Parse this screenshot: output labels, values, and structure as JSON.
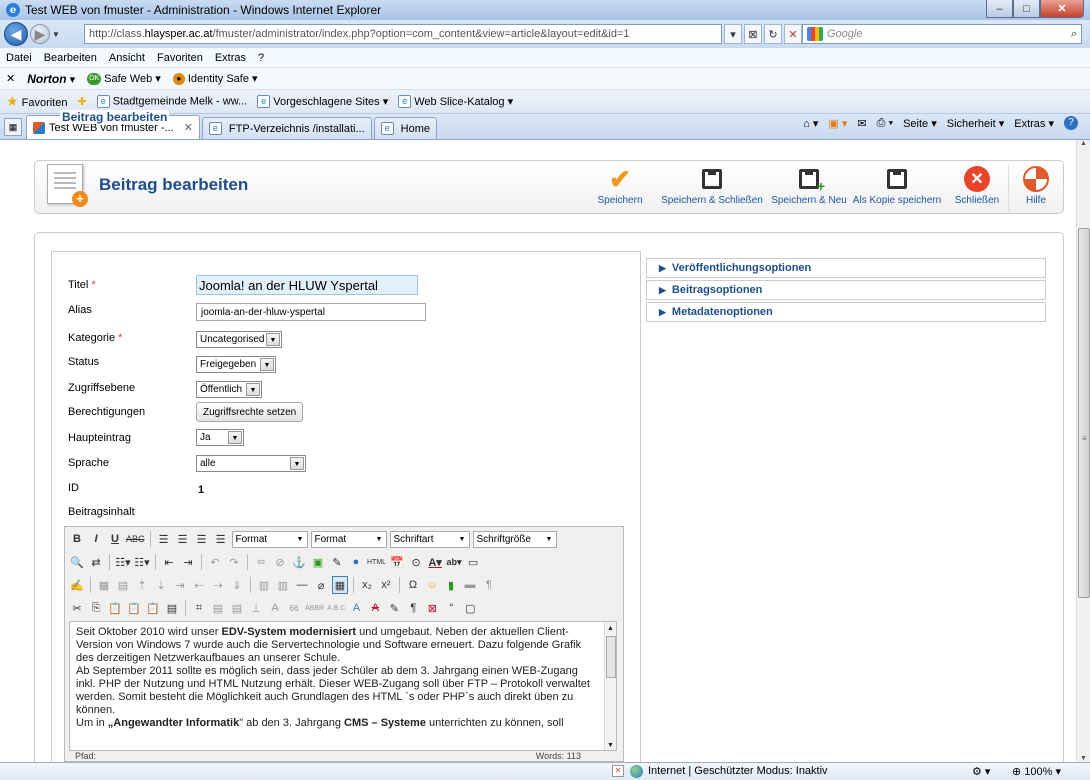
{
  "window": {
    "title": "Test WEB von fmuster - Administration - Windows Internet Explorer"
  },
  "browser": {
    "url_prefix": "http://class.",
    "url_domain": "hlaysper.ac.at",
    "url_suffix": "/fmuster/administrator/index.php?option=com_content&view=article&layout=edit&id=1",
    "search_placeholder": "Google"
  },
  "menu": [
    "Datei",
    "Bearbeiten",
    "Ansicht",
    "Favoriten",
    "Extras",
    "?"
  ],
  "norton": {
    "brand": "Norton",
    "safe_web": "Safe Web",
    "identity_safe": "Identity Safe"
  },
  "favorites": {
    "label": "Favoriten",
    "items": [
      "Stadtgemeinde Melk - ww...",
      "Vorgeschlagene Sites",
      "Web Slice-Katalog"
    ]
  },
  "tabs": [
    "Test WEB von fmuster -...",
    "FTP-Verzeichnis /installati...",
    "Home"
  ],
  "command_bar": [
    "Seite",
    "Sicherheit",
    "Extras"
  ],
  "toolbar": {
    "title": "Beitrag bearbeiten",
    "buttons": [
      "Speichern",
      "Speichern & Schließen",
      "Speichern & Neu",
      "Als Kopie speichern",
      "Schließen",
      "Hilfe"
    ]
  },
  "form": {
    "legend": "Beitrag bearbeiten",
    "title_label": "Titel",
    "title_value": "Joomla! an der HLUW Yspertal",
    "alias_label": "Alias",
    "alias_value": "joomla-an-der-hluw-yspertal",
    "category_label": "Kategorie",
    "category_value": "Uncategorised",
    "status_label": "Status",
    "status_value": "Freigegeben",
    "access_label": "Zugriffsebene",
    "access_value": "Öffentlich",
    "permissions_label": "Berechtigungen",
    "permissions_button": "Zugriffsrechte setzen",
    "featured_label": "Haupteintrag",
    "featured_value": "Ja",
    "language_label": "Sprache",
    "language_value": "alle",
    "id_label": "ID",
    "id_value": "1",
    "content_label": "Beitragsinhalt",
    "required_mark": "*"
  },
  "editor": {
    "format1": "Format",
    "format2": "Format",
    "font": "Schriftart",
    "font_size": "Schriftgröße",
    "p1_a": "Seit Oktober 2010 wird unser ",
    "p1_b": "EDV-System modernisiert",
    "p1_c": " und umgebaut. Neben der aktuellen Client-Version von Windows 7 wurde auch die Servertechnologie und Software erneuert. Dazu folgende Grafik des derzeitigen Netzwerkaufbaues an unserer Schule.",
    "p2": "Ab September 2011 sollte es möglich sein, dass jeder Schüler ab dem 3. Jahrgang einen WEB-Zugang inkl. PHP der Nutzung und HTML Nutzung erhält. Dieser WEB-Zugang soll über FTP – Protokoll verwaltet werden. Somit besteht die Möglichkeit auch Grundlagen des HTML `s oder PHP´s auch direkt üben zu können.",
    "p3_a": "Um in ",
    "p3_b": "„Angewandter Informatik",
    "p3_c": "\" ab den 3. Jahrgang ",
    "p3_d": "CMS – Systeme",
    "p3_e": " unterrichten zu können, soll",
    "path": "Pfad:",
    "words": "Words: 113"
  },
  "accordion": [
    "Veröffentlichungsoptionen",
    "Beitragsoptionen",
    "Metadatenoptionen"
  ],
  "status": {
    "zone": "Internet | Geschützter Modus: Inaktiv",
    "zoom": "100%"
  }
}
